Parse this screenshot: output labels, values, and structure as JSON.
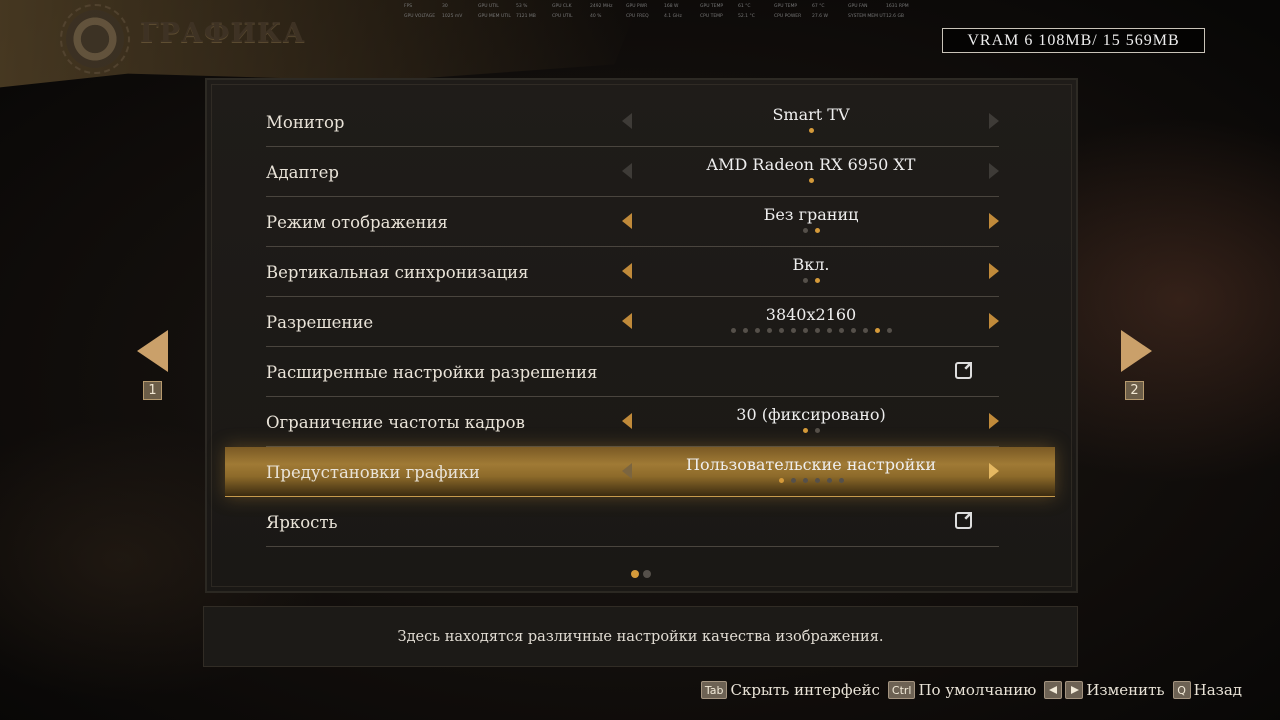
{
  "header": {
    "title": "ГРАФИКА",
    "icon": "gear-icon"
  },
  "perf_overlay": [
    [
      "FPS",
      "30",
      "GPU UTIL",
      "53 %",
      "GPU CLK",
      "2492 MHz",
      "GPU PWR",
      "168 W",
      "GPU TEMP",
      "61 °C",
      "GPU TEMP",
      "67 °C",
      "GPU FAN",
      "1631 RPM"
    ],
    [
      "GPU VOLTAGE",
      "1025 mV",
      "GPU MEM UTIL",
      "7121 MB",
      "CPU UTIL",
      "40 %",
      "CPU FREQ",
      "4.1 GHz",
      "CPU TEMP",
      "52.1 °C",
      "CPU POWER",
      "27.6 W",
      "SYSTEM MEM UTIL",
      "12.6 GB"
    ]
  ],
  "vram": "VRAM 6 108MB/ 15 569MB",
  "settings": [
    {
      "label": "Монитор",
      "value": "Smart TV",
      "dots": 1,
      "active": 0,
      "arrows": "dim"
    },
    {
      "label": "Адаптер",
      "value": "AMD Radeon RX 6950 XT",
      "dots": 1,
      "active": 0,
      "arrows": "dim"
    },
    {
      "label": "Режим отображения",
      "value": "Без границ",
      "dots": 2,
      "active": 1,
      "arrows": "on"
    },
    {
      "label": "Вертикальная синхронизация",
      "value": "Вкл.",
      "dots": 2,
      "active": 1,
      "arrows": "on"
    },
    {
      "label": "Разрешение",
      "value": "3840x2160",
      "dots": 14,
      "active": 12,
      "arrows": "on"
    },
    {
      "label": "Расширенные настройки разрешения",
      "value": "",
      "type": "link"
    },
    {
      "label": "Ограничение частоты кадров",
      "value": "30 (фиксировано)",
      "dots": 2,
      "active": 0,
      "arrows": "on"
    },
    {
      "label": "Предустановки графики",
      "value": "Пользовательские настройки",
      "dots": 6,
      "active": 0,
      "arrows": "on",
      "highlighted": true
    },
    {
      "label": "Яркость",
      "value": "",
      "type": "link"
    }
  ],
  "page_indicator": {
    "pages": 2,
    "active": 0
  },
  "side_nav": {
    "left": "1",
    "right": "2"
  },
  "description": "Здесь находятся различные настройки качества изображения.",
  "hints": [
    {
      "key": "Tab",
      "label": "Скрыть интерфейс"
    },
    {
      "key": "Ctrl",
      "label": "По умолчанию"
    },
    {
      "key": "arrows",
      "label": "Изменить"
    },
    {
      "key": "Q",
      "label": "Назад"
    }
  ],
  "colors": {
    "accent": "#c08a3a",
    "dot_active": "#d59a3a",
    "highlight": "#a07a35"
  }
}
